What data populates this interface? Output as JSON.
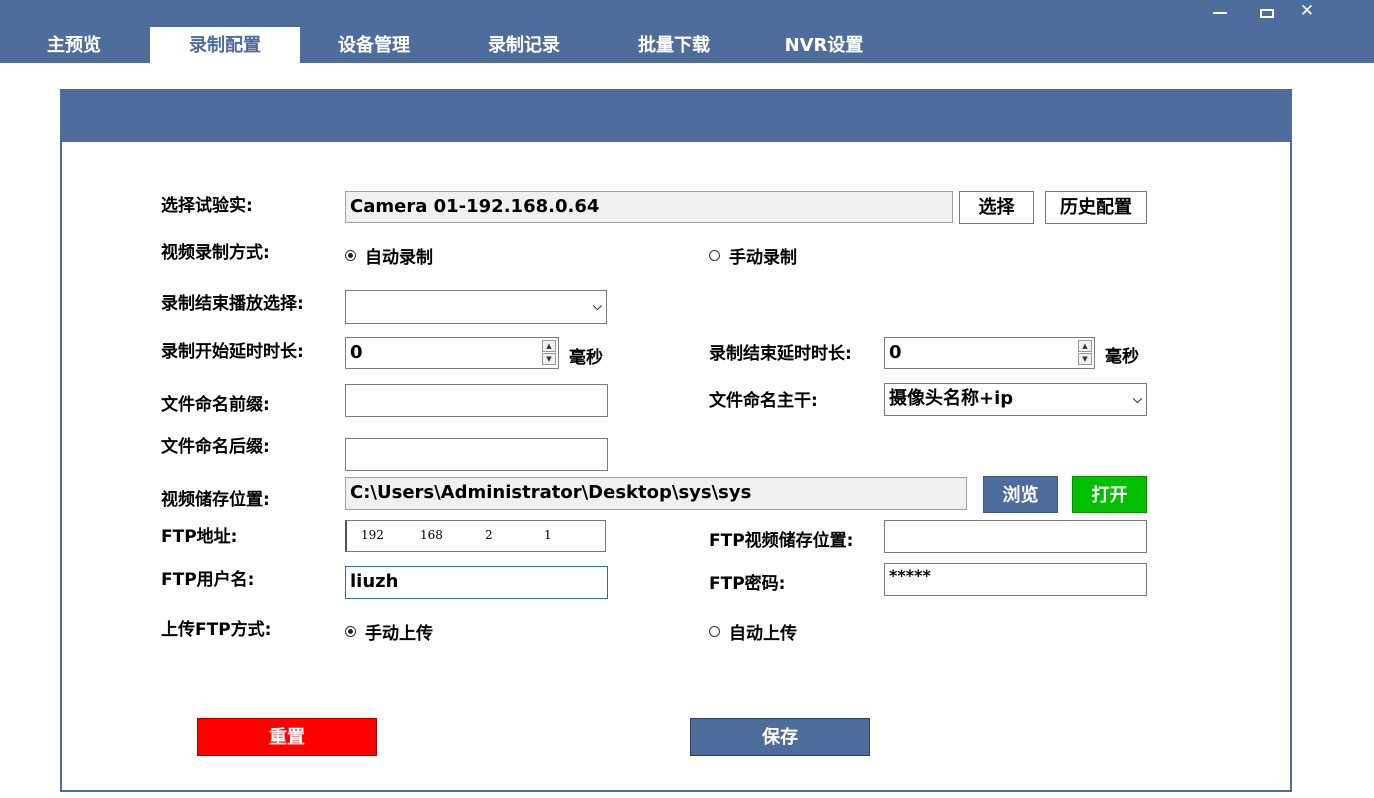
{
  "tabs": [
    "主预览",
    "录制配置",
    "设备管理",
    "录制记录",
    "批量下载",
    "NVR设置"
  ],
  "window": {
    "minimize": "—",
    "maximize": "□",
    "close": "✕"
  },
  "form": {
    "lab_label": "选择试验实:",
    "lab_value": "Camera 01-192.168.0.64",
    "select_btn": "选择",
    "history_btn": "历史配置",
    "record_mode_label": "视频录制方式:",
    "record_mode_auto": "自动录制",
    "record_mode_manual": "手动录制",
    "end_play_label": "录制结束播放选择:",
    "end_play_value": "",
    "start_delay_label": "录制开始延时时长:",
    "start_delay_value": "0",
    "start_delay_unit": "毫秒",
    "end_delay_label": "录制结束延时时长:",
    "end_delay_value": "0",
    "end_delay_unit": "毫秒",
    "prefix_label": "文件命名前缀:",
    "prefix_value": "",
    "stem_label": "文件命名主干:",
    "stem_value": "摄像头名称+ip",
    "suffix_label": "文件命名后缀:",
    "suffix_value": "",
    "storage_label": "视频储存位置:",
    "storage_value": "C:\\Users\\Administrator\\Desktop\\sys\\sys",
    "browse_btn": "浏览",
    "open_btn": "打开",
    "ftp_addr_label": "FTP地址:",
    "ftp_ip": [
      "192",
      "168",
      "2",
      "1"
    ],
    "ftp_storage_label": "FTP视频储存位置:",
    "ftp_storage_value": "",
    "ftp_user_label": "FTP用户名:",
    "ftp_user_value": "liuzh",
    "ftp_pwd_label": "FTP密码:",
    "ftp_pwd_value": "*****",
    "upload_mode_label": "上传FTP方式:",
    "upload_manual": "手动上传",
    "upload_auto": "自动上传",
    "reset_btn": "重置",
    "save_btn": "保存"
  },
  "colors": {
    "brand": "#4e6c9c",
    "reset": "#ff0000",
    "open": "#00c000"
  }
}
